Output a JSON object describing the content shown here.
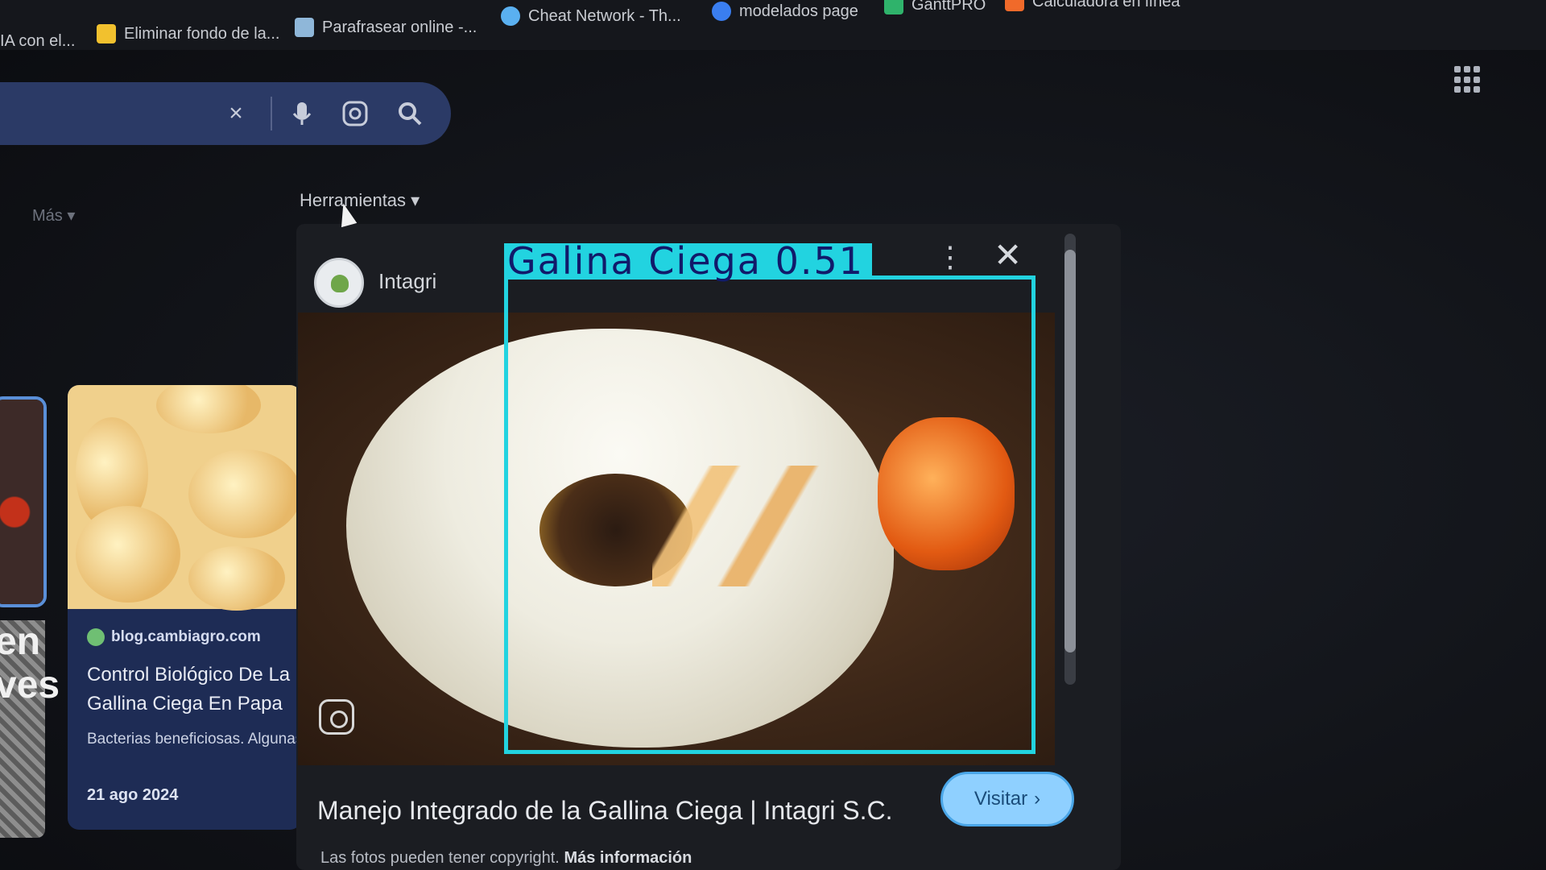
{
  "bookmarks": [
    {
      "label": "IA con el...",
      "icon": "bookmark-icon",
      "color": "#3b7de0"
    },
    {
      "label": "Eliminar fondo de la...",
      "icon": "remove-bg-icon",
      "color": "#f2c12e"
    },
    {
      "label": "Parafrasear online -...",
      "icon": "paraphrase-icon",
      "color": "#8fb7d9"
    },
    {
      "label": "Cheat Network - Th...",
      "icon": "cheat-network-icon",
      "color": "#5ab0f0"
    },
    {
      "label": "modelados page",
      "icon": "globe-icon",
      "color": "#3a7ef0"
    },
    {
      "label": "GanttPRO",
      "icon": "ganttpro-icon",
      "color": "#2fb36b"
    },
    {
      "label": "Calculadora en línea",
      "icon": "calculator-icon",
      "color": "#f06a2a"
    }
  ],
  "search": {
    "clear_icon": "×"
  },
  "tabs": {
    "more": "Más ▾",
    "tools": "Herramientas ▾"
  },
  "results": {
    "blog": {
      "site": "blog.cambiagro.com",
      "title": "Control Biológico De La Gallina Ciega En Papa",
      "desc": "Bacterias beneficiosas. Algunas bacterias del suelo, como Bacillus thuringiensis...",
      "date": "21 ago 2024"
    },
    "left_partial_text": "en\nves"
  },
  "preview": {
    "source": "Intagri",
    "more_icon": "⋮",
    "close_icon": "✕",
    "caption": "Manejo Integrado de la Gallina Ciega | Intagri S.C.",
    "visit_label": "Visitar",
    "visit_arrow": "›",
    "copyright": "Las fotos pueden tener copyright.",
    "more_info": "Más información"
  },
  "detection": {
    "label": "Galina Ciega 0.51",
    "color": "#22d3e0"
  }
}
